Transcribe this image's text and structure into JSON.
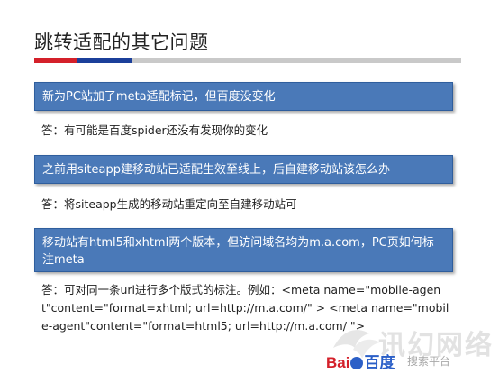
{
  "slide": {
    "title": "跳转适配的其它问题"
  },
  "qa": [
    {
      "question": "新为PC站加了meta适配标记，但百度没变化",
      "answer": "答：有可能是百度spider还没有发现你的变化"
    },
    {
      "question": "之前用siteapp建移动站已适配生效至线上，后自建移动站该怎么办",
      "answer": "答：将siteapp生成的移动站重定向至自建移动站可"
    },
    {
      "question": "移动站有html5和xhtml两个版本，但访问域名均为m.a.com，PC页如何标注meta",
      "answer": "答：可对同一条url进行多个版式的标注。例如：<meta name=\"mobile-agent\"content=\"format=xhtml; url=http://m.a.com/\" >    <meta name=\"mobile-agent\"content=\"format=html5; url=http://m.a.com/ \">"
    }
  ],
  "branding": {
    "logo_bai": "Bai",
    "logo_du": "百度",
    "logo_tail": "搜索平台",
    "watermark": "讯幻网络"
  },
  "colors": {
    "accent_red": "#d4202a",
    "accent_blue": "#1b3f9a",
    "question_bg": "#4a79b8"
  }
}
